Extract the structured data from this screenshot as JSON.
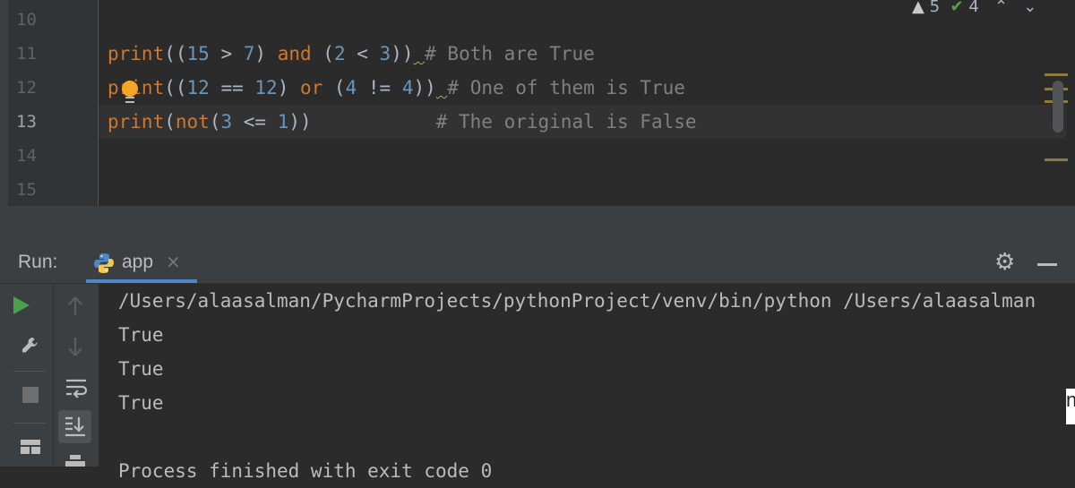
{
  "editor": {
    "inspections": {
      "warnings": "5",
      "typos": "4"
    },
    "lines": [
      {
        "num": "10"
      },
      {
        "num": "11"
      },
      {
        "num": "12"
      },
      {
        "num": "13"
      },
      {
        "num": "14"
      },
      {
        "num": "15"
      }
    ],
    "code": {
      "l11": {
        "fn": "print",
        "p1": "((",
        "n1": "15",
        "op1": " > ",
        "n2": "7",
        "p2": ") ",
        "kw": "and",
        "p3": " (",
        "n3": "2",
        "op2": " < ",
        "n4": "3",
        "p4": "))",
        "sp": " ",
        "comment": "# Both are True"
      },
      "l12": {
        "fn": "print",
        "p1": "((",
        "n1": "12",
        "op1": " == ",
        "n2": "12",
        "p2": ") ",
        "kw": "or",
        "p3": " (",
        "n3": "4",
        "op2": " != ",
        "n4": "4",
        "p4": "))",
        "sp": " ",
        "comment": "# One of them is True"
      },
      "l13": {
        "fn": "print",
        "p1": "(",
        "kw": "not",
        "p2": "(",
        "n1": "3",
        "op1": " <= ",
        "n2": "1",
        "p3": "))",
        "sp": "           ",
        "comment": "# The original is False"
      }
    }
  },
  "run": {
    "title": "Run:",
    "tab_label": "app",
    "tab_close": "×",
    "console_lines": [
      "/Users/alaasalman/PycharmProjects/pythonProject/venv/bin/python /Users/alaasalman",
      "True",
      "True",
      "True",
      "",
      "Process finished with exit code 0"
    ],
    "edge_char": "n"
  },
  "icons": {
    "warning": "warning-triangle-icon",
    "typo": "typo-check-icon",
    "up": "chevron-up-icon",
    "down": "chevron-down-icon",
    "gear": "gear-icon",
    "minimize": "minimize-icon",
    "run": "run-icon",
    "wrench": "wrench-icon",
    "stop": "stop-icon",
    "layout": "layout-icon",
    "arrow_up": "arrow-up-icon",
    "arrow_down": "arrow-down-icon",
    "soft_wrap": "soft-wrap-icon",
    "scroll_end": "scroll-to-end-icon",
    "print": "print-icon"
  },
  "colors": {
    "keyword": "#cc7832",
    "number": "#6897bb",
    "comment": "#808080",
    "run_green": "#49a04f",
    "tab_underline": "#4a88c7"
  }
}
